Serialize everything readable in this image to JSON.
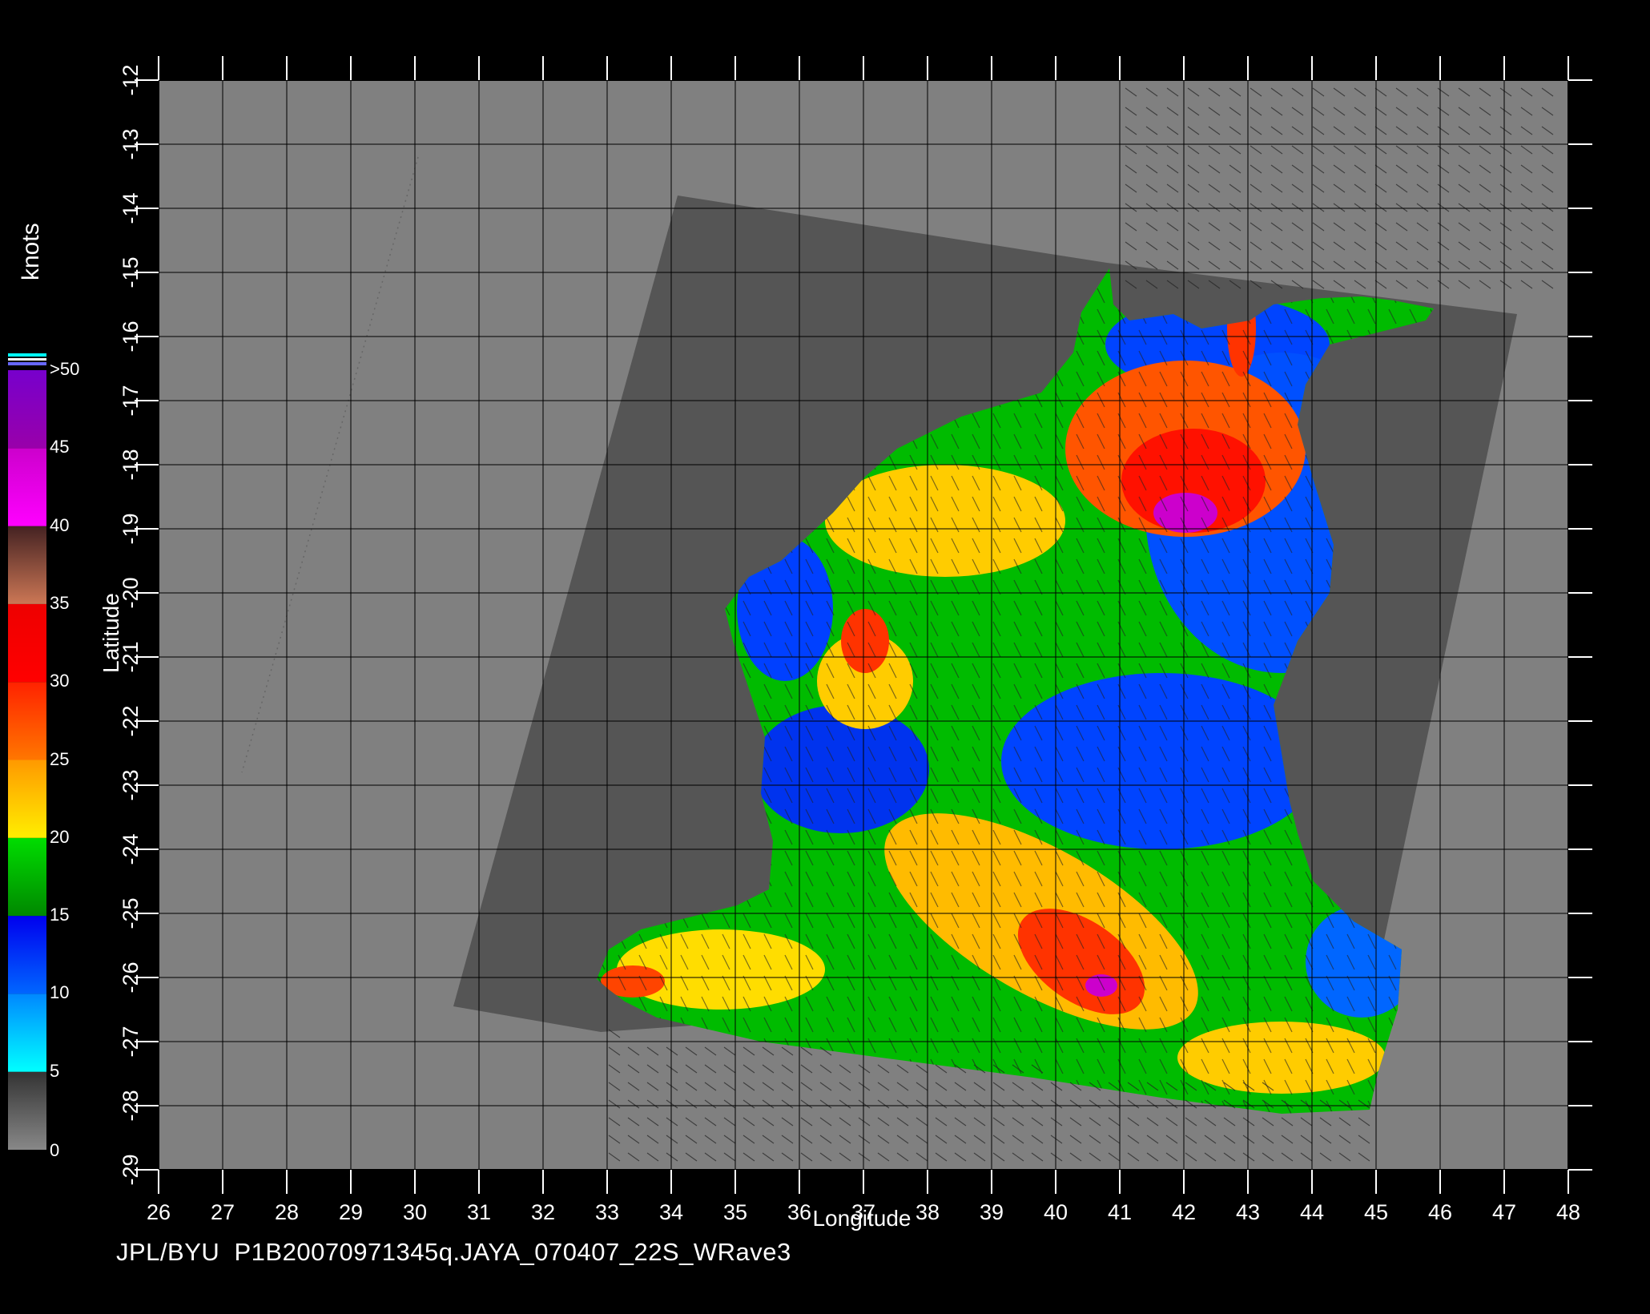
{
  "footer": {
    "caption": "JPL/BYU  P1B20070971345q.JAYA_070407_22S_WRave3"
  },
  "map": {
    "xlabel": "Longitude",
    "ylabel": "Latitude",
    "lon_range": [
      26,
      48
    ],
    "lat_range": [
      -29,
      -12
    ],
    "lon_ticks": [
      "26",
      "27",
      "28",
      "29",
      "30",
      "31",
      "32",
      "33",
      "34",
      "35",
      "36",
      "37",
      "38",
      "39",
      "40",
      "41",
      "42",
      "43",
      "44",
      "45",
      "46",
      "47",
      "48"
    ],
    "lat_ticks": [
      "-12",
      "-13",
      "-14",
      "-15",
      "-16",
      "-17",
      "-18",
      "-19",
      "-20",
      "-21",
      "-22",
      "-23",
      "-24",
      "-25",
      "-26",
      "-27",
      "-28",
      "-29"
    ],
    "grid": true,
    "background_color": "#808080",
    "swath_color": "#555555"
  },
  "colorbar": {
    "unit": "knots",
    "labels": [
      "0",
      "5",
      "10",
      "15",
      "20",
      "25",
      "30",
      "35",
      "40",
      "45",
      ">50"
    ],
    "bands": [
      {
        "from": 0,
        "to": 5,
        "colors": [
          "#888888",
          "#333333"
        ]
      },
      {
        "from": 5,
        "to": 10,
        "colors": [
          "#00ffff",
          "#0088ff"
        ]
      },
      {
        "from": 10,
        "to": 15,
        "colors": [
          "#0066ff",
          "#0000ee"
        ]
      },
      {
        "from": 15,
        "to": 20,
        "colors": [
          "#008800",
          "#00dd00"
        ]
      },
      {
        "from": 20,
        "to": 25,
        "colors": [
          "#ffee00",
          "#ff9900"
        ]
      },
      {
        "from": 25,
        "to": 30,
        "colors": [
          "#ff7700",
          "#ff2200"
        ]
      },
      {
        "from": 30,
        "to": 35,
        "colors": [
          "#ff0000",
          "#ee0000"
        ]
      },
      {
        "from": 35,
        "to": 40,
        "colors": [
          "#cc7755",
          "#442222"
        ]
      },
      {
        "from": 40,
        "to": 45,
        "colors": [
          "#ff00ff",
          "#cc00cc"
        ]
      },
      {
        "from": 45,
        "to": 50,
        "colors": [
          "#9900aa",
          "#7700cc"
        ]
      }
    ]
  }
}
